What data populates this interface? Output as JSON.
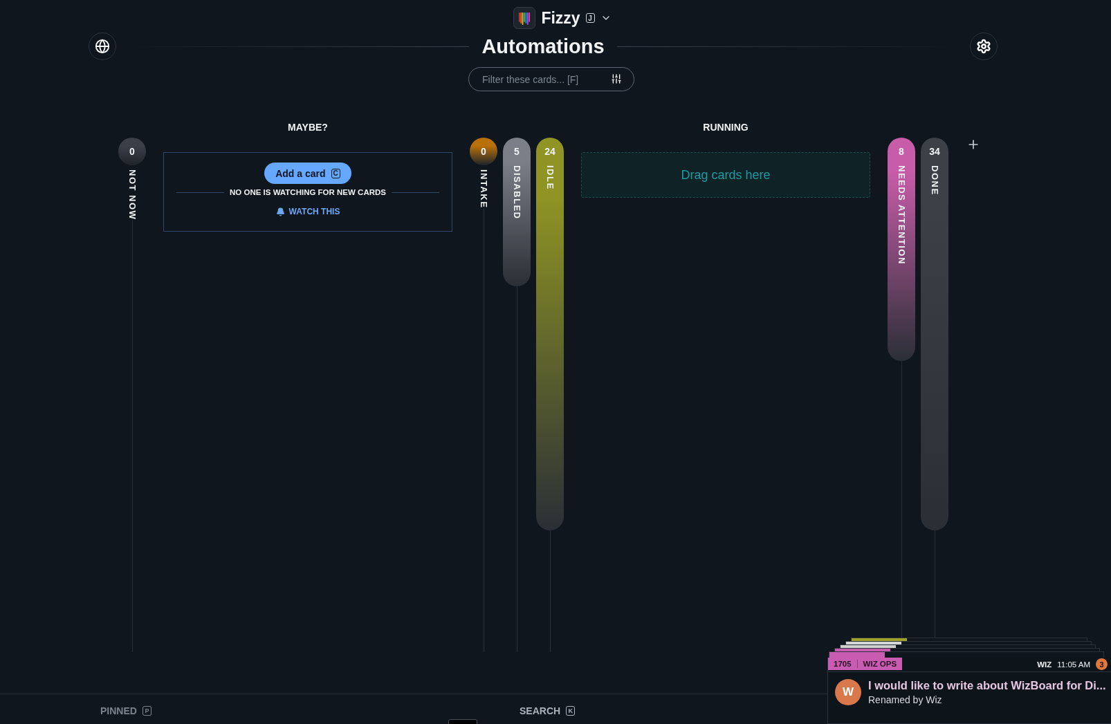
{
  "app": {
    "name": "Fizzy",
    "shortcut": "J"
  },
  "page_title": "Automations",
  "filter": {
    "placeholder": "Filter these cards... [F]"
  },
  "board": {
    "columns": [
      {
        "kind": "pill",
        "label": "NOT NOW",
        "count": "0",
        "color": "#3b4048"
      },
      {
        "kind": "section",
        "title": "MAYBE?",
        "add_button": {
          "label": "Add a card",
          "shortcut": "C"
        },
        "notice": "NO ONE IS WATCHING FOR NEW CARDS",
        "watch_link": "WATCH THIS"
      },
      {
        "kind": "pill",
        "label": "INTAKE",
        "count": "0",
        "color": "#b8700a"
      },
      {
        "kind": "pill",
        "label": "DISABLED",
        "count": "5",
        "color": "#7a7f88"
      },
      {
        "kind": "pill",
        "label": "IDLE",
        "count": "24",
        "color": "#8f9424"
      },
      {
        "kind": "section",
        "title": "RUNNING",
        "dropzone": "Drag cards here"
      },
      {
        "kind": "pill",
        "label": "NEEDS ATTENTION",
        "count": "8",
        "color": "#c75ca8"
      },
      {
        "kind": "pill",
        "label": "DONE",
        "count": "34",
        "color": "#3c4047"
      },
      {
        "kind": "add"
      }
    ]
  },
  "footer": {
    "items": [
      {
        "label": "PINNED",
        "shortcut": "P",
        "disabled": true
      },
      {
        "label": "SEARCH",
        "shortcut": "K",
        "disabled": false
      }
    ]
  },
  "notification": {
    "number": "1705",
    "board": "WIZ OPS",
    "color": "#c75cb0",
    "author": "WIZ",
    "time": "11:05 AM",
    "badge": "3",
    "avatar": "W",
    "title": "I would like to write about WizBoard for Di...",
    "subtitle": "Renamed by Wiz",
    "stack": [
      {
        "color": "#a3a32a"
      },
      {
        "color": "#d6d6d6"
      },
      {
        "color": "#d0d0d0"
      },
      {
        "color": "#c75cb0"
      },
      {
        "color": "#c75cb0"
      }
    ]
  }
}
